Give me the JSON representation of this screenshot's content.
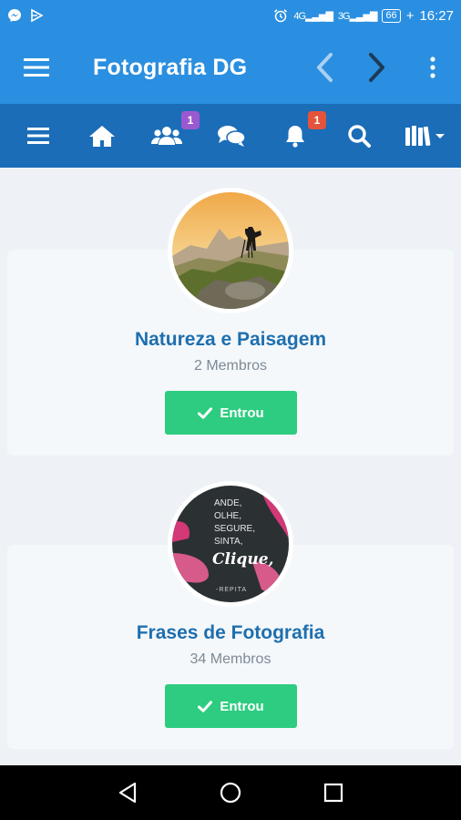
{
  "status_bar": {
    "left_icons": [
      "messenger-icon",
      "play-icon"
    ],
    "right_icons": [
      "alarm-icon",
      "signal-icon",
      "signal-icon",
      "battery-icon"
    ],
    "signal1": "4G",
    "signal2": "3G",
    "battery": "66",
    "time": "16:27"
  },
  "app_bar": {
    "title": "Fotografia DG",
    "icons": [
      "menu-icon",
      "back-icon",
      "forward-icon",
      "more-icon"
    ]
  },
  "toolbar": {
    "icons": [
      "list-icon",
      "home-icon",
      "members-icon",
      "chat-icon",
      "bell-icon",
      "search-icon",
      "library-icon"
    ],
    "members_badge": "1",
    "notifications_badge": "1"
  },
  "groups": [
    {
      "name": "Natureza e Paisagem",
      "members": "2 Membros",
      "button": "Entrou"
    },
    {
      "name": "Frases de Fotografia",
      "members": "34 Membros",
      "button": "Entrou"
    }
  ],
  "quote_image": {
    "lines": [
      "ANDE,",
      "OLHE,",
      "SEGURE,",
      "SINTA,"
    ],
    "script": "Clique,",
    "footer": "-REPITA"
  },
  "colors": {
    "primary": "#2a8fe0",
    "primary_dark": "#1b6db8",
    "join": "#2ecc80",
    "title_text": "#1f6fae"
  }
}
